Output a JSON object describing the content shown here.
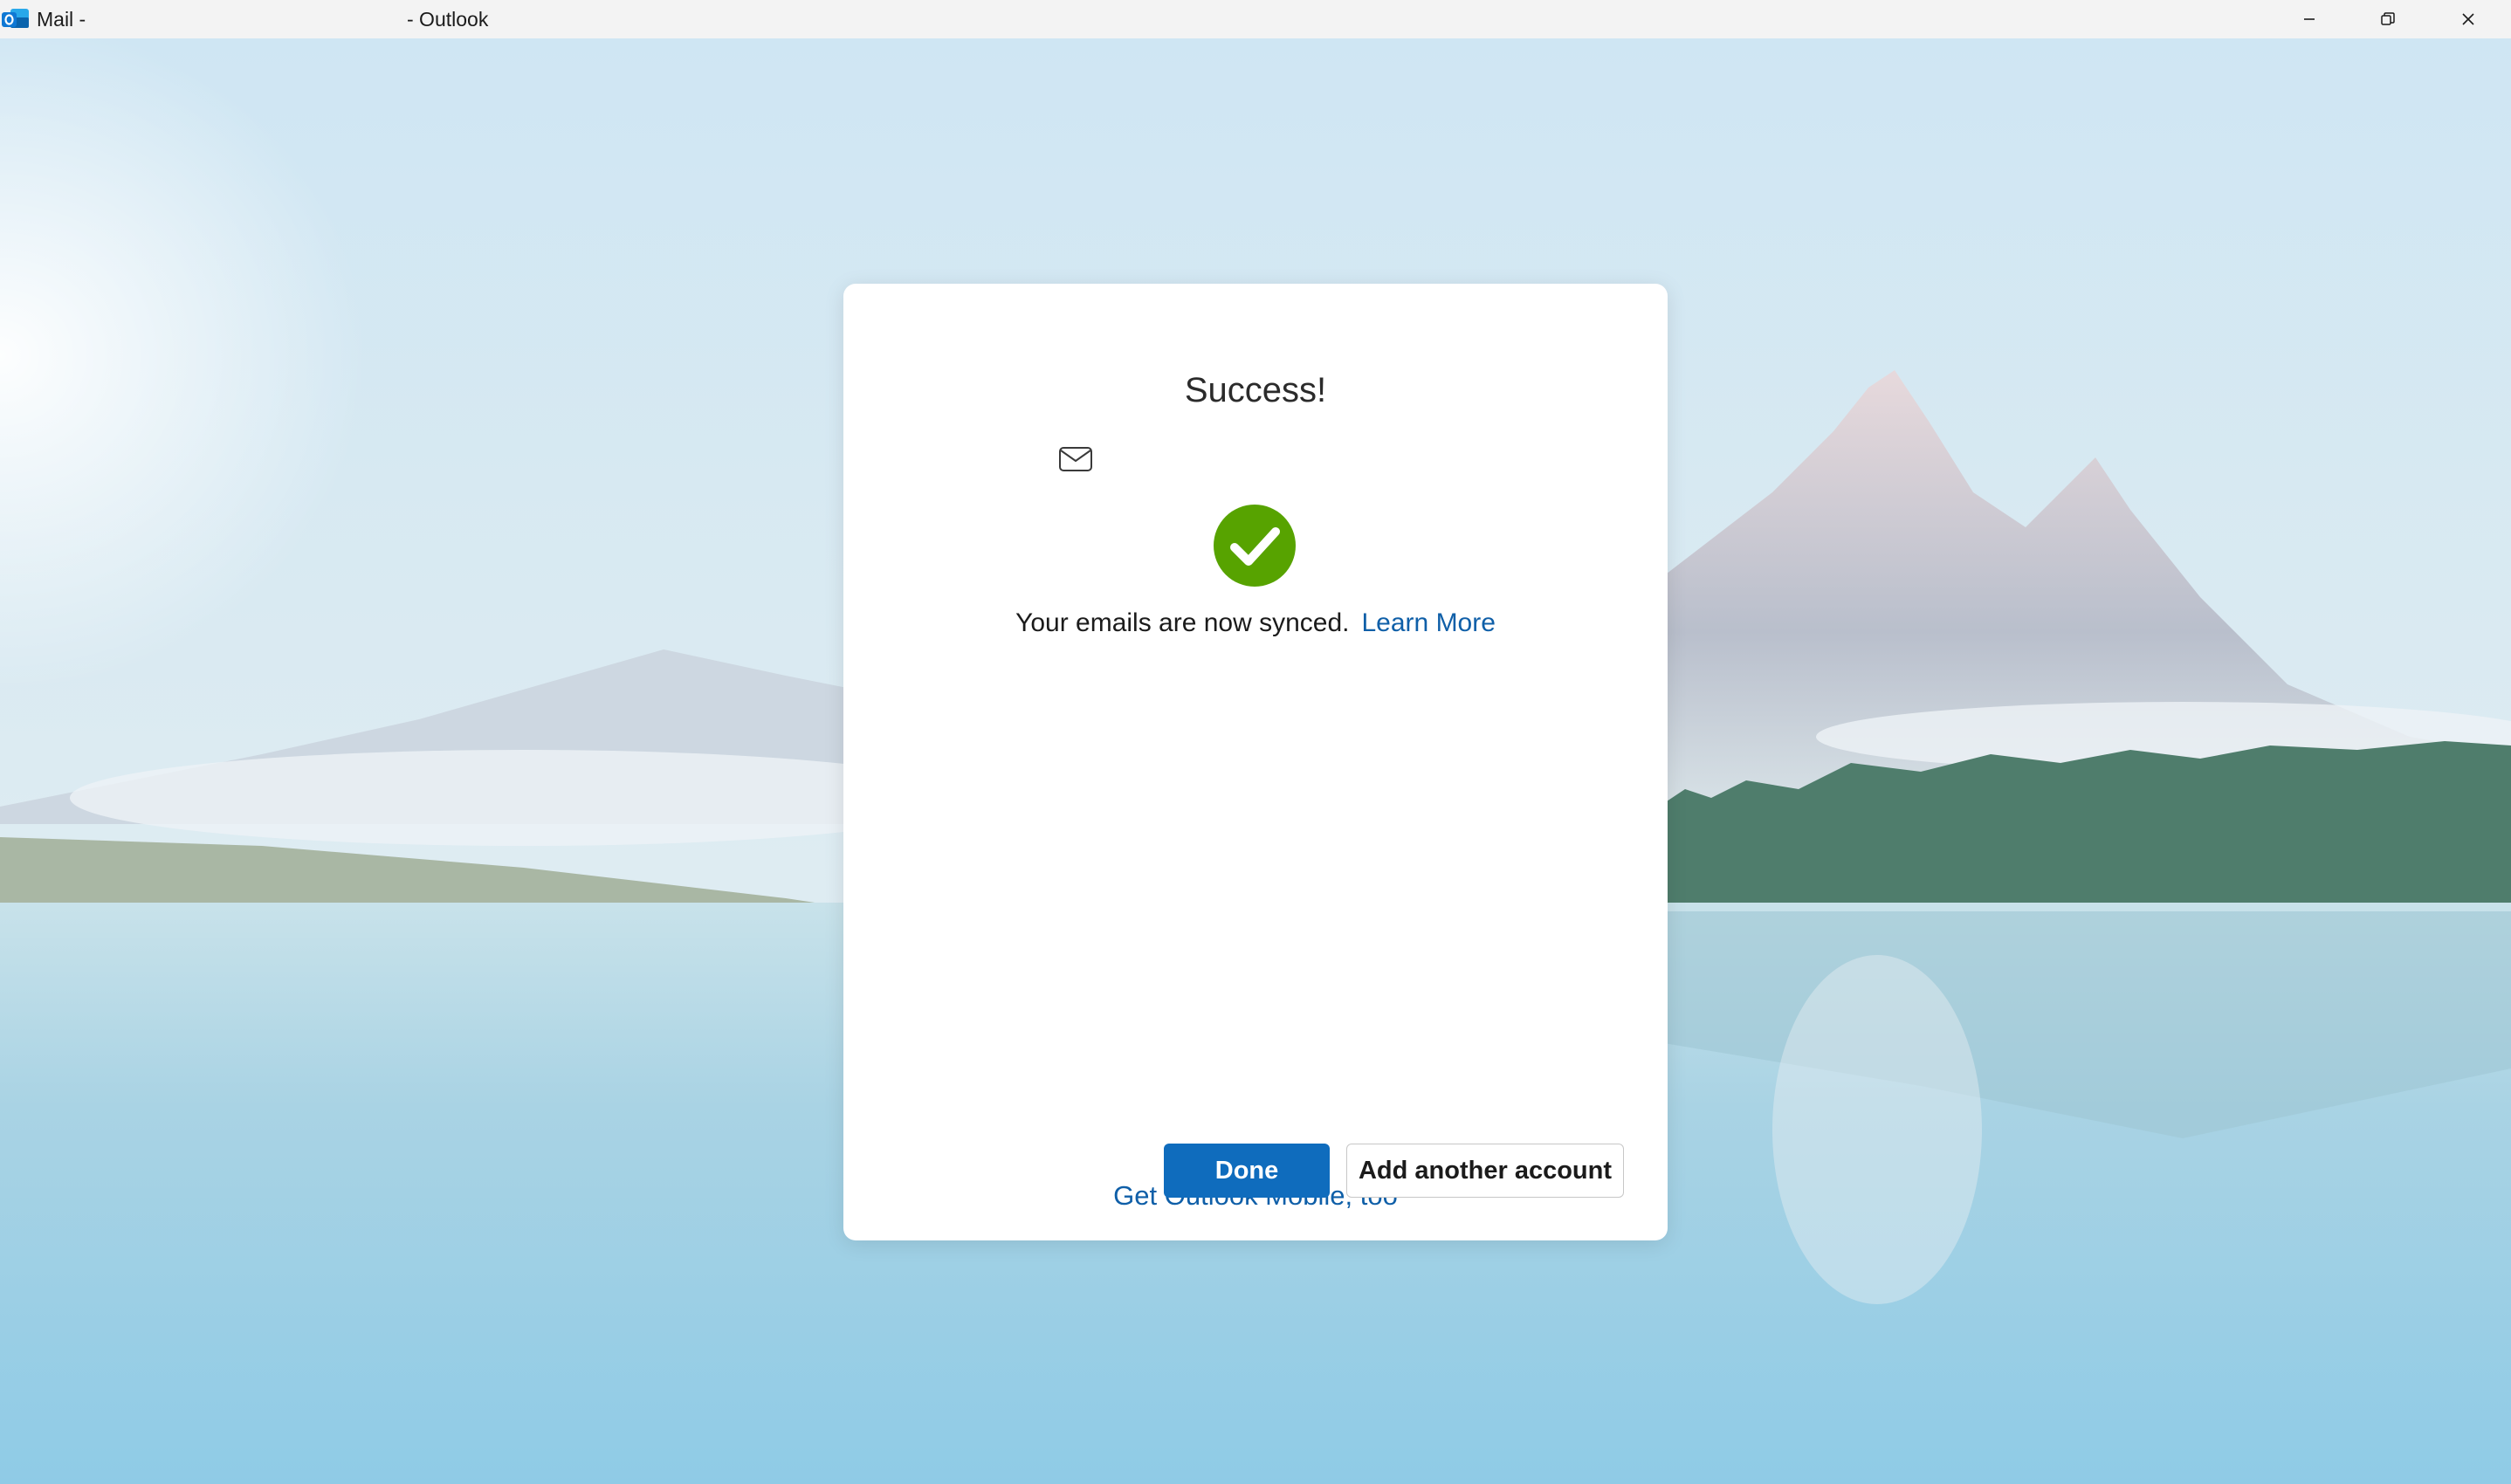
{
  "window": {
    "title_app": "Mail -",
    "title_product": "- Outlook",
    "minimize_label": "Minimize",
    "restore_label": "Restore",
    "close_label": "Close"
  },
  "dialog": {
    "heading": "Success!",
    "message": "Your emails are now synced.",
    "learn_more": "Learn More",
    "done_label": "Done",
    "add_account_label": "Add another account",
    "mobile_link": "Get Outlook Mobile, too"
  },
  "icons": {
    "app": "outlook-icon",
    "mail": "mail-envelope-icon",
    "status": "success-check-icon"
  },
  "colors": {
    "accent": "#0f6cbd",
    "link": "#0f5fa8",
    "success": "#57a300"
  }
}
